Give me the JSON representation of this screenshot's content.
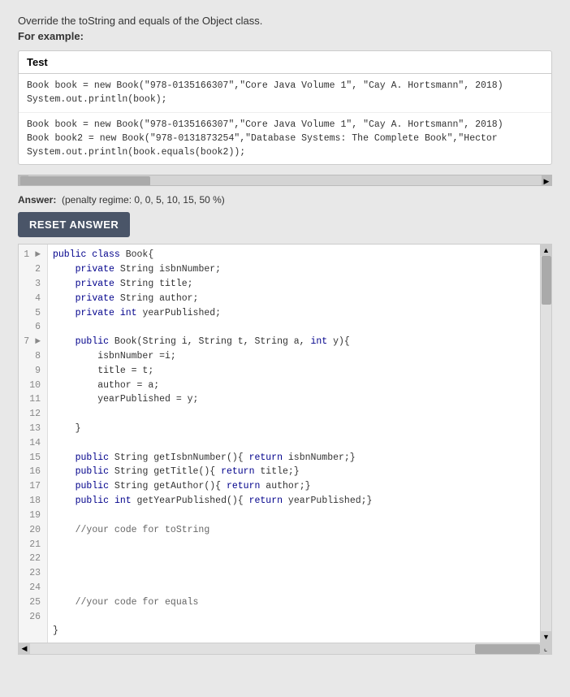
{
  "description": "Override the toString and equals of the Object class.",
  "for_example_label": "For example:",
  "test_section": {
    "header": "Test",
    "block1": [
      "Book book = new Book(\"978-0135166307\",\"Core Java Volume 1\", \"Cay A. Hortsmann\", 2018)",
      "System.out.println(book);"
    ],
    "block2": [
      "Book book = new Book(\"978-0135166307\",\"Core Java Volume 1\", \"Cay A. Hortsmann\", 2018)",
      "Book book2 = new Book(\"978-0131873254\",\"Database Systems: The Complete Book\",\"Hector",
      "System.out.println(book.equals(book2));"
    ]
  },
  "answer_label": "Answer:",
  "answer_penalty": "(penalty regime: 0, 0, 5, 10, 15, 50 %)",
  "reset_button_label": "RESET ANSWER",
  "code_lines": [
    {
      "num": 1,
      "content": "public class Book{",
      "marker": true
    },
    {
      "num": 2,
      "content": "    private String isbnNumber;"
    },
    {
      "num": 3,
      "content": "    private String title;"
    },
    {
      "num": 4,
      "content": "    private String author;"
    },
    {
      "num": 5,
      "content": "    private int yearPublished;"
    },
    {
      "num": 6,
      "content": ""
    },
    {
      "num": 7,
      "content": "    public Book(String i, String t, String a, int y){",
      "marker": true
    },
    {
      "num": 8,
      "content": "        isbnNumber =i;"
    },
    {
      "num": 9,
      "content": "        title = t;"
    },
    {
      "num": 10,
      "content": "        author = a;"
    },
    {
      "num": 11,
      "content": "        yearPublished = y;"
    },
    {
      "num": 12,
      "content": ""
    },
    {
      "num": 13,
      "content": "    }"
    },
    {
      "num": 14,
      "content": ""
    },
    {
      "num": 15,
      "content": "    public String getIsbnNumber(){ return isbnNumber;}"
    },
    {
      "num": 16,
      "content": "    public String getTitle(){ return title;}"
    },
    {
      "num": 17,
      "content": "    public String getAuthor(){ return author;}"
    },
    {
      "num": 18,
      "content": "    public int getYearPublished(){ return yearPublished;}"
    },
    {
      "num": 19,
      "content": ""
    },
    {
      "num": 20,
      "content": "    //your code for toString"
    },
    {
      "num": 21,
      "content": ""
    },
    {
      "num": 22,
      "content": ""
    },
    {
      "num": 23,
      "content": ""
    },
    {
      "num": 24,
      "content": "    //your code for equals"
    },
    {
      "num": 25,
      "content": ""
    },
    {
      "num": 26,
      "content": "}"
    }
  ]
}
